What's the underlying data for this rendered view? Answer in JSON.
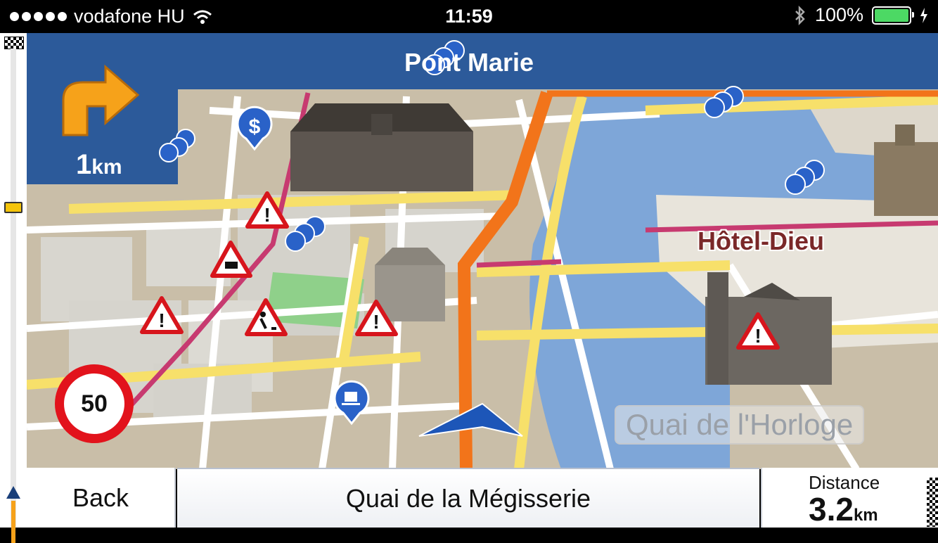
{
  "status_bar": {
    "carrier": "vodafone HU",
    "time": "11:59",
    "battery": "100%"
  },
  "navigation": {
    "next_street": "Pont Marie",
    "turn_distance_value": "1",
    "turn_distance_unit": "km",
    "turn_direction": "turn-right-icon",
    "speed_limit": "50"
  },
  "map_labels": {
    "landmark": "Hôtel-Dieu",
    "street_label": "Quai de l'Horloge"
  },
  "bottom_bar": {
    "back_label": "Back",
    "current_street": "Quai de la Mégisserie",
    "distance_label": "Distance",
    "distance_value": "3.2",
    "distance_unit": "km"
  },
  "colors": {
    "header": "#2c5a9a",
    "route": "#f2741a",
    "river": "#7ea6d8",
    "road_major": "#f7e06a"
  }
}
